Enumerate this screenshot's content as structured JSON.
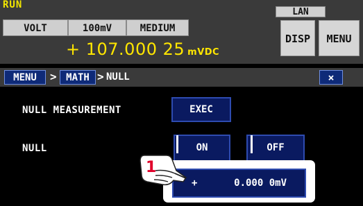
{
  "status": {
    "run": "RUN",
    "lan": "LAN"
  },
  "measurement": {
    "function": "VOLT",
    "range": "100mV",
    "rate": "MEDIUM",
    "value": "+ 107.000 25",
    "unit": "mVDC"
  },
  "top_buttons": {
    "disp": "DISP",
    "menu": "MENU"
  },
  "breadcrumb": {
    "menu": "MENU",
    "math": "MATH",
    "current": "NULL",
    "separator": ">"
  },
  "close_label": "×",
  "null_measurement": {
    "label": "NULL MEASUREMENT",
    "exec_label": "EXEC"
  },
  "null": {
    "label": "NULL",
    "on_label": "ON",
    "off_label": "OFF",
    "value_sign": "+",
    "value": "0.000 0mV"
  },
  "callout": {
    "step": "1",
    "icon": "pointing-hand-icon"
  },
  "colors": {
    "reading": "#ffe600",
    "run_text": "#f2e600",
    "button_fill": "#0a1a60",
    "button_border": "#2e4bb0",
    "step_number": "#e0002a"
  }
}
